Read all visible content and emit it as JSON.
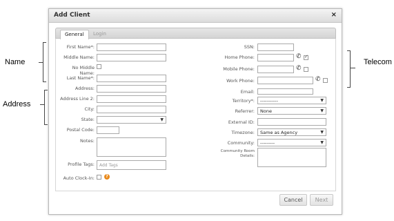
{
  "annotations": {
    "name": "Name",
    "address": "Address",
    "telecom": "Telecom"
  },
  "dialog": {
    "title": "Add Client",
    "close": "×"
  },
  "tabs": [
    {
      "label": "General",
      "active": true
    },
    {
      "label": "Login",
      "active": false
    }
  ],
  "left": {
    "first_name": "First Name*:",
    "middle_name": "Middle Name:",
    "no_middle_name": "No Middle Name:",
    "last_name": "Last Name*:",
    "address": "Address:",
    "address2": "Address Line 2:",
    "city": "City:",
    "state": "State:",
    "postal_code": "Postal Code:",
    "notes": "Notes:",
    "profile_tags": "Profile Tags:",
    "profile_tags_placeholder": "Add Tags",
    "auto_clock_in": "Auto Clock-In:",
    "help_icon": "?"
  },
  "right": {
    "ssn": "SSN:",
    "home_phone": "Home Phone:",
    "home_phone_checked": true,
    "mobile_phone": "Mobile Phone:",
    "work_phone": "Work Phone:",
    "email": "Email:",
    "territory": "Territory*:",
    "territory_value": "-----------",
    "referrer": "Referrer:",
    "referrer_value": "None",
    "external_id": "External ID:",
    "timezone": "Timezone:",
    "timezone_value": "Same as Agency",
    "community": "Community:",
    "community_value": "---------",
    "community_room_details": "Community Room Details:"
  },
  "buttons": {
    "cancel": "Cancel",
    "next": "Next"
  }
}
